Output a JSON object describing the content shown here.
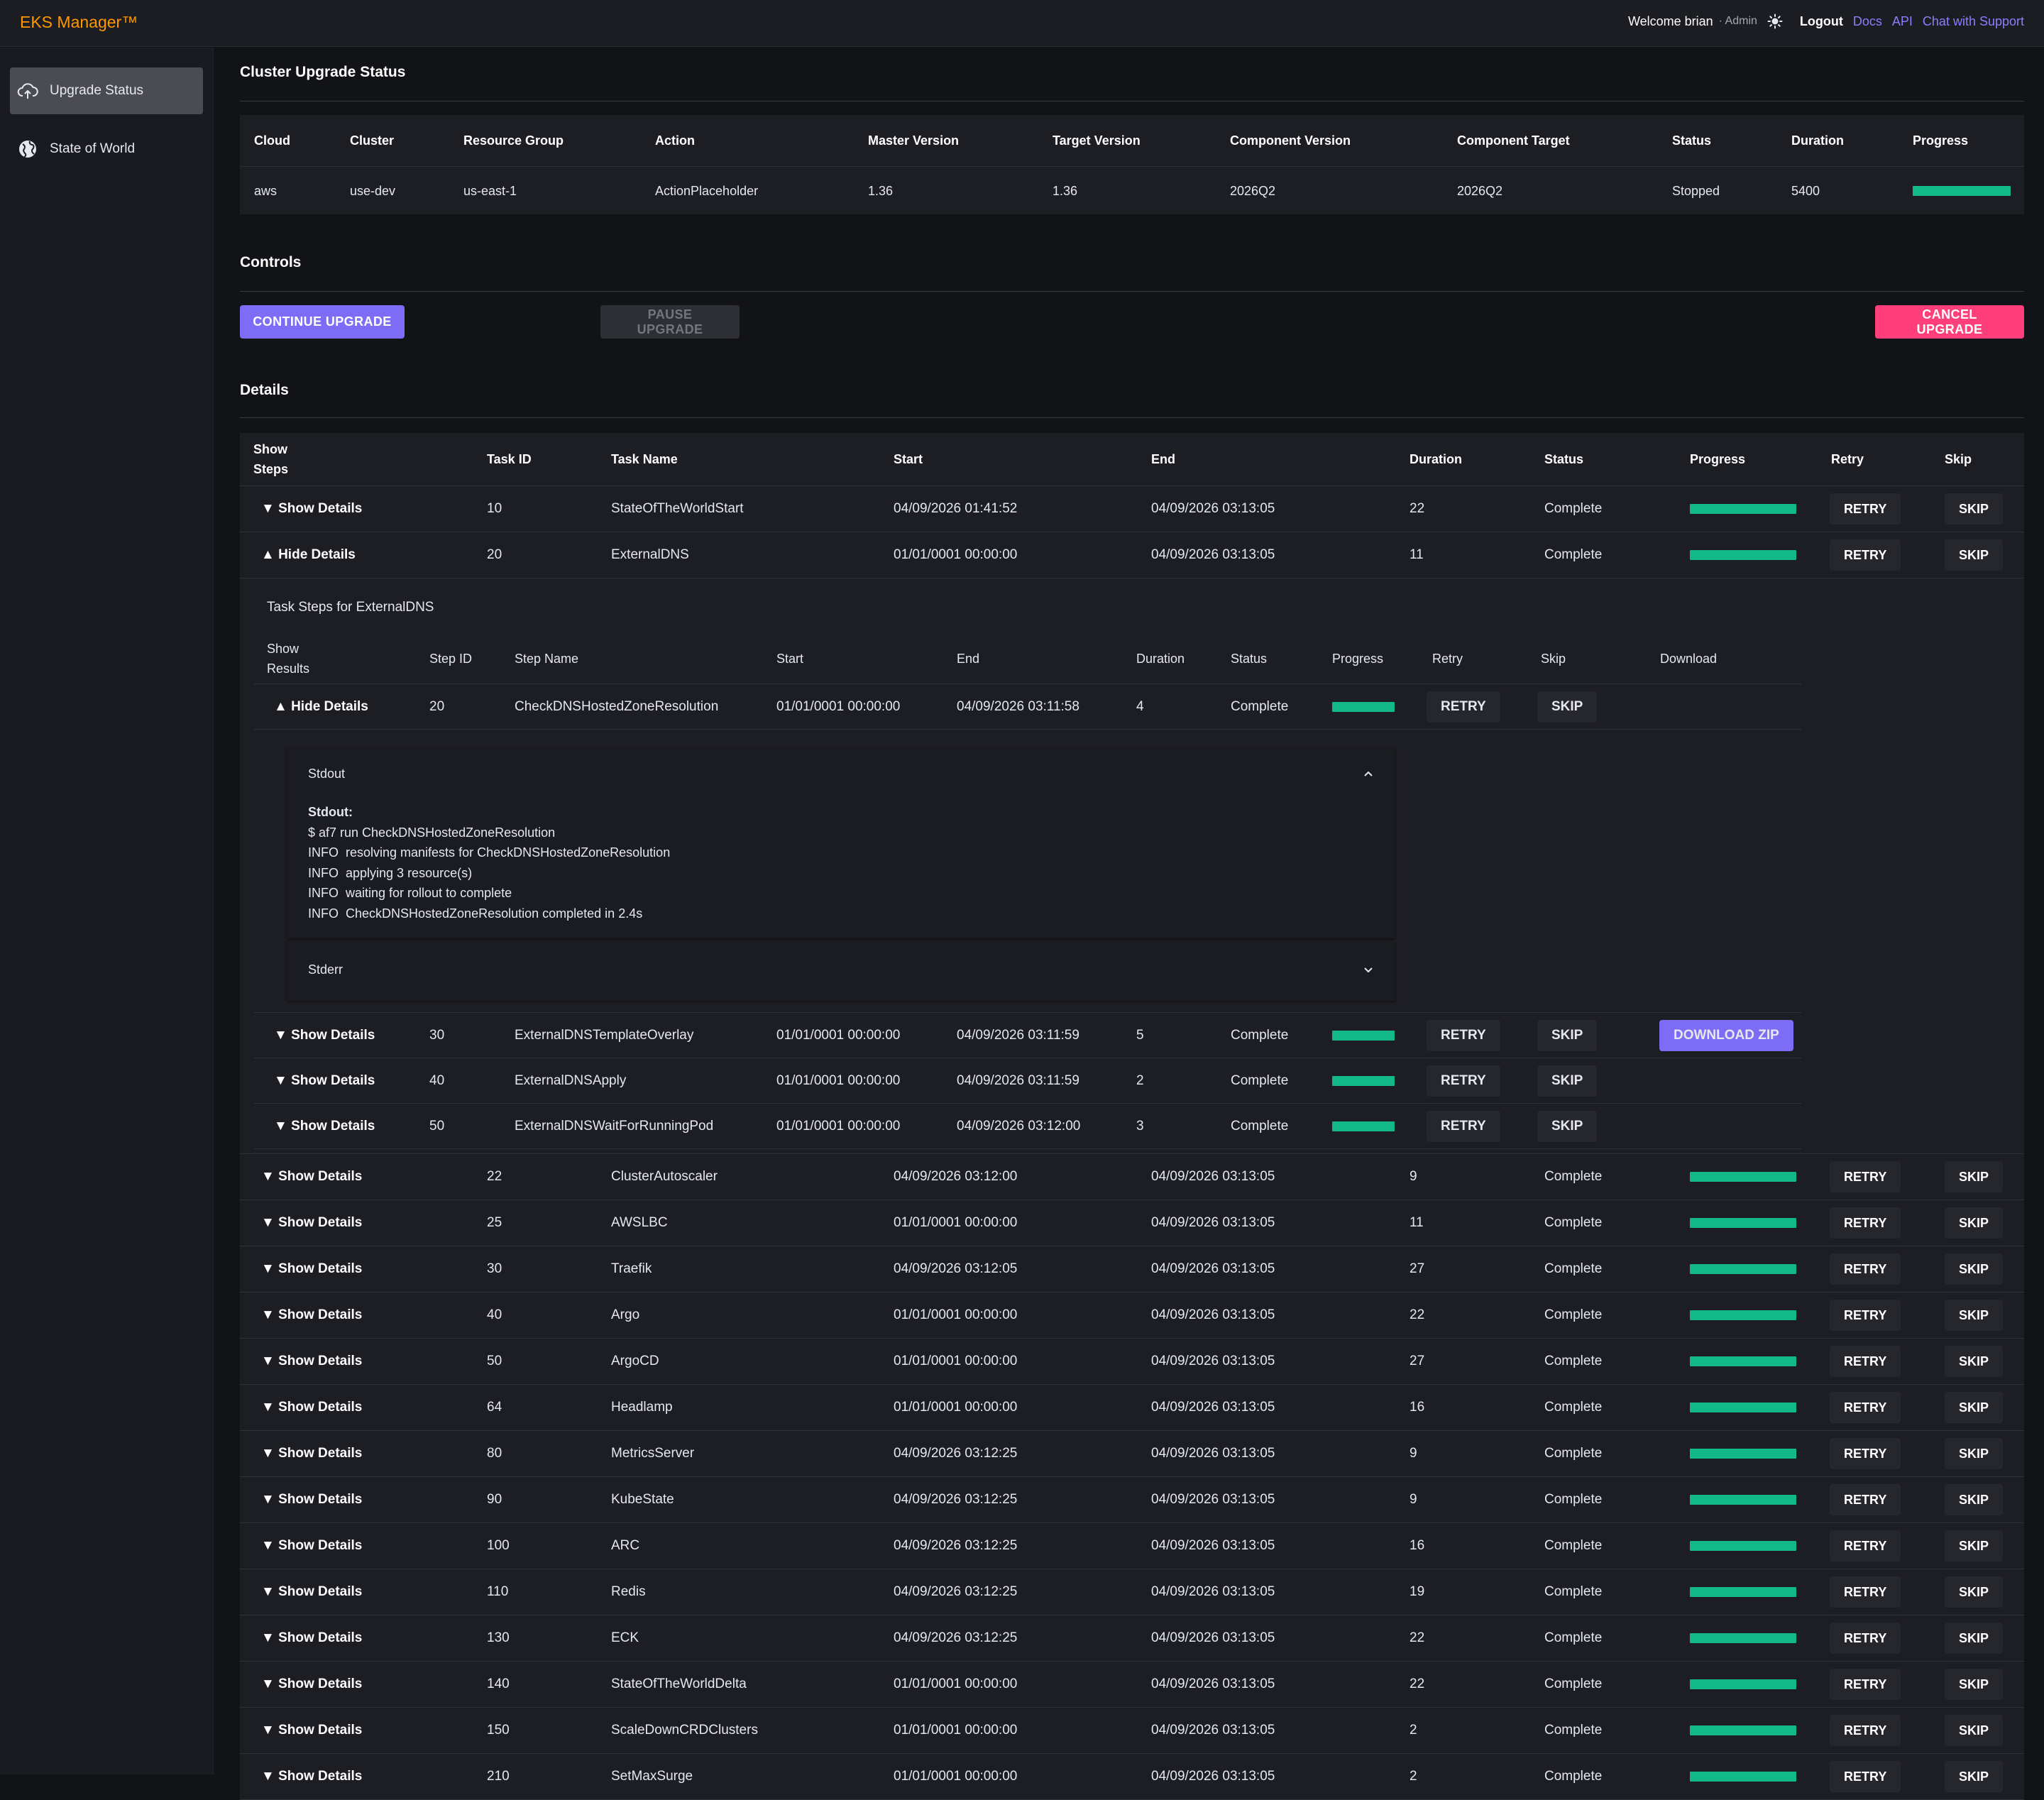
{
  "app": {
    "brand": "EKS Manager™",
    "welcome": "Welcome brian",
    "role": "· Admin",
    "logout": "Logout",
    "links": [
      "Docs",
      "API",
      "Chat with Support"
    ]
  },
  "sidebar": {
    "items": [
      {
        "label": "Upgrade Status",
        "icon": "cloud-upload-icon",
        "active": true
      },
      {
        "label": "State of World",
        "icon": "globe-icon",
        "active": false
      }
    ]
  },
  "status": {
    "title": "Cluster Upgrade Status",
    "columns": [
      "Cloud",
      "Cluster",
      "Resource Group",
      "Action",
      "Master Version",
      "Target Version",
      "Component Version",
      "Component Target",
      "Status",
      "Duration",
      "Progress"
    ],
    "row": {
      "cloud": "aws",
      "cluster": "use-dev",
      "resource_group": "us-east-1",
      "action": "ActionPlaceholder",
      "master_version": "1.36",
      "target_version": "1.36",
      "component_version": "2026Q2",
      "component_target": "2026Q2",
      "status": "Stopped",
      "duration": "5400",
      "progress": 1.0
    }
  },
  "controls": {
    "title": "Controls",
    "continue": "CONTINUE UPGRADE",
    "pause": "PAUSE UPGRADE",
    "cancel": "CANCEL UPGRADE"
  },
  "details": {
    "title": "Details",
    "columns": {
      "show_steps": "Show\nSteps",
      "task_id": "Task ID",
      "task_name": "Task Name",
      "start": "Start",
      "end": "End",
      "duration": "Duration",
      "status": "Status",
      "progress": "Progress",
      "retry": "Retry",
      "skip": "Skip"
    },
    "show_label": "▼ Show Details",
    "hide_label": "▲ Hide Details",
    "retry": "RETRY",
    "skip": "SKIP",
    "tasks_before": [
      {
        "id": "10",
        "name": "StateOfTheWorldStart",
        "start": "04/09/2026 01:41:52",
        "end": "04/09/2026 03:13:05",
        "duration": "22",
        "status": "Complete",
        "progress": 1.0,
        "expanded": false
      },
      {
        "id": "20",
        "name": "ExternalDNS",
        "start": "01/01/0001 00:00:00",
        "end": "04/09/2026 03:13:05",
        "duration": "11",
        "status": "Complete",
        "progress": 1.0,
        "expanded": true
      }
    ],
    "steps": {
      "title": "Task Steps for ExternalDNS",
      "columns": {
        "show_results": "Show\nResults",
        "step_id": "Step ID",
        "step_name": "Step Name",
        "start": "Start",
        "end": "End",
        "duration": "Duration",
        "status": "Status",
        "progress": "Progress",
        "retry": "Retry",
        "skip": "Skip",
        "download": "Download"
      },
      "download_label": "DOWNLOAD ZIP",
      "first": {
        "id": "20",
        "name": "CheckDNSHostedZoneResolution",
        "start": "01/01/0001 00:00:00",
        "end": "04/09/2026 03:11:58",
        "duration": "4",
        "status": "Complete",
        "progress": 1.0
      },
      "stdout_title": "Stdout",
      "stdout_heading": "Stdout:",
      "stdout_lines": [
        "$ af7 run CheckDNSHostedZoneResolution",
        "INFO  resolving manifests for CheckDNSHostedZoneResolution",
        "INFO  applying 3 resource(s)",
        "INFO  waiting for rollout to complete",
        "INFO  CheckDNSHostedZoneResolution completed in 2.4s"
      ],
      "stderr_title": "Stderr",
      "rest": [
        {
          "id": "30",
          "name": "ExternalDNSTemplateOverlay",
          "start": "01/01/0001 00:00:00",
          "end": "04/09/2026 03:11:59",
          "duration": "5",
          "status": "Complete",
          "progress": 1.0,
          "download": true
        },
        {
          "id": "40",
          "name": "ExternalDNSApply",
          "start": "01/01/0001 00:00:00",
          "end": "04/09/2026 03:11:59",
          "duration": "2",
          "status": "Complete",
          "progress": 1.0,
          "download": false
        },
        {
          "id": "50",
          "name": "ExternalDNSWaitForRunningPod",
          "start": "01/01/0001 00:00:00",
          "end": "04/09/2026 03:12:00",
          "duration": "3",
          "status": "Complete",
          "progress": 1.0,
          "download": false
        }
      ]
    },
    "tasks_after": [
      {
        "id": "22",
        "name": "ClusterAutoscaler",
        "start": "04/09/2026 03:12:00",
        "end": "04/09/2026 03:13:05",
        "duration": "9",
        "status": "Complete",
        "progress": 1.0
      },
      {
        "id": "25",
        "name": "AWSLBC",
        "start": "01/01/0001 00:00:00",
        "end": "04/09/2026 03:13:05",
        "duration": "11",
        "status": "Complete",
        "progress": 1.0
      },
      {
        "id": "30",
        "name": "Traefik",
        "start": "04/09/2026 03:12:05",
        "end": "04/09/2026 03:13:05",
        "duration": "27",
        "status": "Complete",
        "progress": 1.0
      },
      {
        "id": "40",
        "name": "Argo",
        "start": "01/01/0001 00:00:00",
        "end": "04/09/2026 03:13:05",
        "duration": "22",
        "status": "Complete",
        "progress": 1.0
      },
      {
        "id": "50",
        "name": "ArgoCD",
        "start": "01/01/0001 00:00:00",
        "end": "04/09/2026 03:13:05",
        "duration": "27",
        "status": "Complete",
        "progress": 1.0
      },
      {
        "id": "64",
        "name": "Headlamp",
        "start": "01/01/0001 00:00:00",
        "end": "04/09/2026 03:13:05",
        "duration": "16",
        "status": "Complete",
        "progress": 1.0
      },
      {
        "id": "80",
        "name": "MetricsServer",
        "start": "04/09/2026 03:12:25",
        "end": "04/09/2026 03:13:05",
        "duration": "9",
        "status": "Complete",
        "progress": 1.0
      },
      {
        "id": "90",
        "name": "KubeState",
        "start": "04/09/2026 03:12:25",
        "end": "04/09/2026 03:13:05",
        "duration": "9",
        "status": "Complete",
        "progress": 1.0
      },
      {
        "id": "100",
        "name": "ARC",
        "start": "04/09/2026 03:12:25",
        "end": "04/09/2026 03:13:05",
        "duration": "16",
        "status": "Complete",
        "progress": 1.0
      },
      {
        "id": "110",
        "name": "Redis",
        "start": "04/09/2026 03:12:25",
        "end": "04/09/2026 03:13:05",
        "duration": "19",
        "status": "Complete",
        "progress": 1.0
      },
      {
        "id": "130",
        "name": "ECK",
        "start": "04/09/2026 03:12:25",
        "end": "04/09/2026 03:13:05",
        "duration": "22",
        "status": "Complete",
        "progress": 1.0
      },
      {
        "id": "140",
        "name": "StateOfTheWorldDelta",
        "start": "01/01/0001 00:00:00",
        "end": "04/09/2026 03:13:05",
        "duration": "22",
        "status": "Complete",
        "progress": 1.0
      },
      {
        "id": "150",
        "name": "ScaleDownCRDClusters",
        "start": "01/01/0001 00:00:00",
        "end": "04/09/2026 03:13:05",
        "duration": "2",
        "status": "Complete",
        "progress": 1.0
      },
      {
        "id": "210",
        "name": "SetMaxSurge",
        "start": "01/01/0001 00:00:00",
        "end": "04/09/2026 03:13:05",
        "duration": "2",
        "status": "Complete",
        "progress": 1.0
      }
    ]
  },
  "colors": {
    "accent": "#7c6cf6",
    "brand": "#ff9800",
    "danger": "#ff3f7b",
    "progress": "#12b886",
    "link": "#8c7dff"
  }
}
